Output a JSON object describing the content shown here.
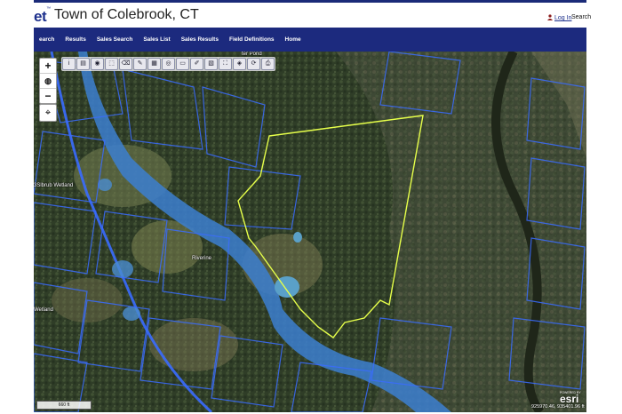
{
  "header": {
    "brand": "et",
    "brand_tm": "™",
    "town_title": "Town of Colebrook, CT",
    "login_label": "Log In",
    "search_label": "Search"
  },
  "nav": {
    "items": [
      "earch",
      "Results",
      "Sales Search",
      "Sales List",
      "Sales Results",
      "Field Definitions",
      "Home"
    ]
  },
  "map": {
    "labels": {
      "pond": "ter Pond",
      "wetland1": "3Slbrub Wetland",
      "riverine": "Riverine",
      "wetland2": "Wetland"
    },
    "scale": "660 ft",
    "coordinates": "925970.46, 935401.96 ft",
    "esri_powered": "POWERED BY",
    "esri_logo": "esri"
  },
  "colors": {
    "nav_bg": "#1c2a7e",
    "brand": "#1c2f8c",
    "parcel_line": "#3a6cff",
    "selected_parcel": "#e6ff4a"
  },
  "icons": [
    "zoom-in-icon",
    "zoom-out-icon",
    "globe-icon",
    "locate-icon"
  ]
}
